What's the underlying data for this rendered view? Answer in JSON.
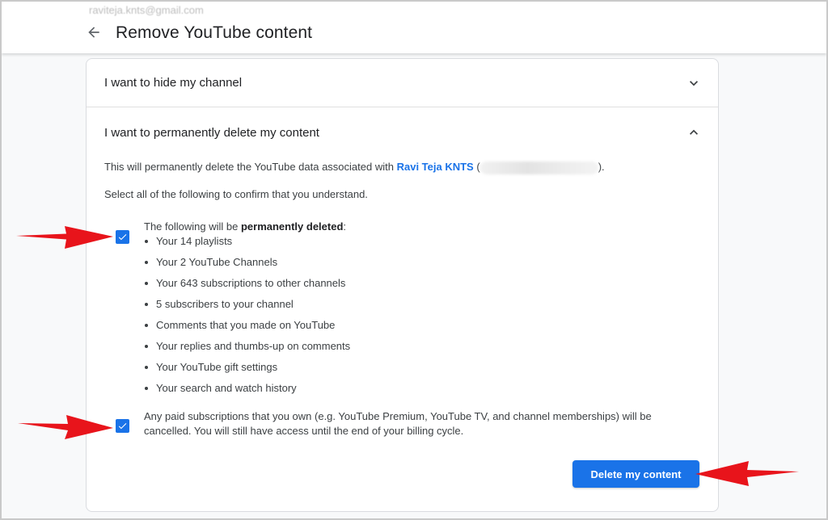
{
  "header": {
    "account_email": "raviteja.knts@gmail.com",
    "title": "Remove YouTube content",
    "back_icon": "arrow-back-icon"
  },
  "sections": {
    "hide": {
      "label": "I want to hide my channel",
      "expanded": false
    },
    "delete": {
      "label": "I want to permanently delete my content",
      "expanded": true
    }
  },
  "delete_section": {
    "intro_prefix": "This will permanently delete the YouTube data associated with",
    "channel_name": "Ravi Teja KNTS",
    "paren_open": "(",
    "paren_close": ").",
    "confirm_text": "Select all of the following to confirm that you understand.",
    "checkbox1": {
      "checked": true,
      "lead": "The following will be",
      "bold": "permanently deleted",
      "suffix": ":"
    },
    "items": [
      "Your 14 playlists",
      "Your 2 YouTube Channels",
      "Your 643 subscriptions to other channels",
      "5 subscribers to your channel",
      "Comments that you made on YouTube",
      "Your replies and thumbs-up on comments",
      "Your YouTube gift settings",
      "Your search and watch history"
    ],
    "checkbox2": {
      "checked": true,
      "line1": "Any paid subscriptions that you own (e.g. YouTube Premium, YouTube TV, and channel memberships) will be",
      "line2": "cancelled. You will still have access until the end of your billing cycle."
    },
    "delete_button": "Delete my content"
  },
  "colors": {
    "accent": "#1a73e8",
    "annotation_arrow": "#e8141b"
  }
}
